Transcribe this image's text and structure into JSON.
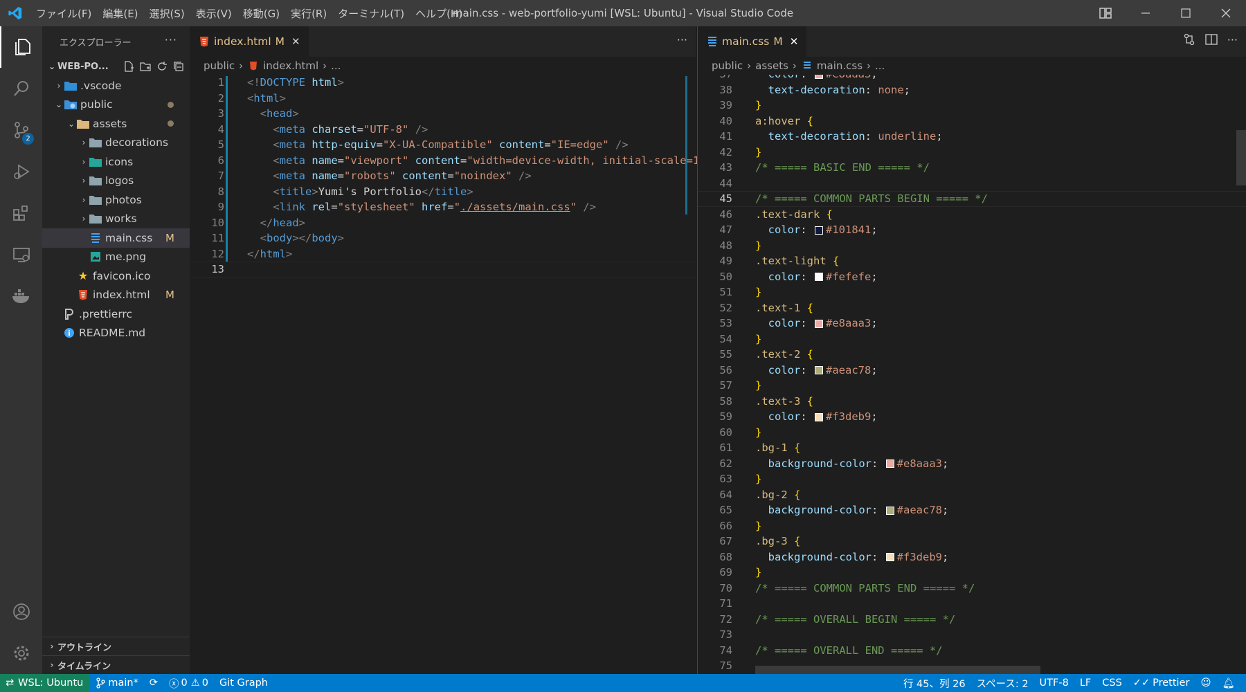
{
  "window": {
    "title": "main.css - web-portfolio-yumi [WSL: Ubuntu] - Visual Studio Code",
    "menu": [
      "ファイル(F)",
      "編集(E)",
      "選択(S)",
      "表示(V)",
      "移動(G)",
      "実行(R)",
      "ターミナル(T)",
      "ヘルプ(H)"
    ]
  },
  "activity": {
    "scm_badge": "2"
  },
  "explorer": {
    "title": "エクスプローラー",
    "root": "WEB-PO...",
    "tree": [
      {
        "label": ".vscode",
        "icon": "vscode-folder-icon",
        "mod": ""
      },
      {
        "label": "public",
        "icon": "public-folder-icon",
        "mod": "dot"
      },
      {
        "label": "assets",
        "icon": "folder-icon",
        "mod": "dot"
      },
      {
        "label": "decorations",
        "icon": "folder-icon",
        "mod": ""
      },
      {
        "label": "icons",
        "icon": "image-folder-icon",
        "mod": ""
      },
      {
        "label": "logos",
        "icon": "folder-icon",
        "mod": ""
      },
      {
        "label": "photos",
        "icon": "folder-icon",
        "mod": ""
      },
      {
        "label": "works",
        "icon": "folder-icon",
        "mod": ""
      },
      {
        "label": "main.css",
        "icon": "css-icon",
        "mod": "M"
      },
      {
        "label": "me.png",
        "icon": "image-icon",
        "mod": ""
      },
      {
        "label": "favicon.ico",
        "icon": "star-icon",
        "mod": ""
      },
      {
        "label": "index.html",
        "icon": "html-icon",
        "mod": "M"
      },
      {
        "label": ".prettierrc",
        "icon": "prettier-icon",
        "mod": ""
      },
      {
        "label": "README.md",
        "icon": "info-icon",
        "mod": ""
      }
    ],
    "outline": "アウトライン",
    "timeline": "タイムライン"
  },
  "editor_left": {
    "tab": {
      "label": "index.html",
      "mod": "M",
      "close": "✕"
    },
    "breadcrumb": [
      "public",
      "index.html",
      "..."
    ],
    "line_numbers": [
      "1",
      "2",
      "3",
      "4",
      "5",
      "6",
      "7",
      "8",
      "9",
      "10",
      "11",
      "12",
      "13"
    ]
  },
  "editor_right": {
    "tab": {
      "label": "main.css",
      "mod": "M",
      "close": "✕"
    },
    "breadcrumb": [
      "public",
      "assets",
      "main.css",
      "..."
    ],
    "line_numbers": [
      "37",
      "38",
      "39",
      "40",
      "41",
      "42",
      "43",
      "44",
      "45",
      "46",
      "47",
      "48",
      "49",
      "50",
      "51",
      "52",
      "53",
      "54",
      "55",
      "56",
      "57",
      "58",
      "59",
      "60",
      "61",
      "62",
      "63",
      "64",
      "65",
      "66",
      "67",
      "68",
      "69",
      "70",
      "71",
      "72",
      "73",
      "74",
      "75"
    ],
    "current_line": "45",
    "swatches": {
      "dark": "#101841",
      "light": "#fefefe",
      "pink": "#e8aaa3",
      "green": "#aeac78",
      "cream": "#f3deb9"
    }
  },
  "status": {
    "remote": "WSL: Ubuntu",
    "branch": "main*",
    "errors": "0",
    "warnings": "0",
    "git_graph": "Git Graph",
    "position": "行 45、列 26",
    "spaces": "スペース: 2",
    "encoding": "UTF-8",
    "eol": "LF",
    "language": "CSS",
    "formatter": "Prettier"
  },
  "colors": {
    "statusbar": "#007acc",
    "remote": "#16825d",
    "modified": "#e2c08d"
  }
}
